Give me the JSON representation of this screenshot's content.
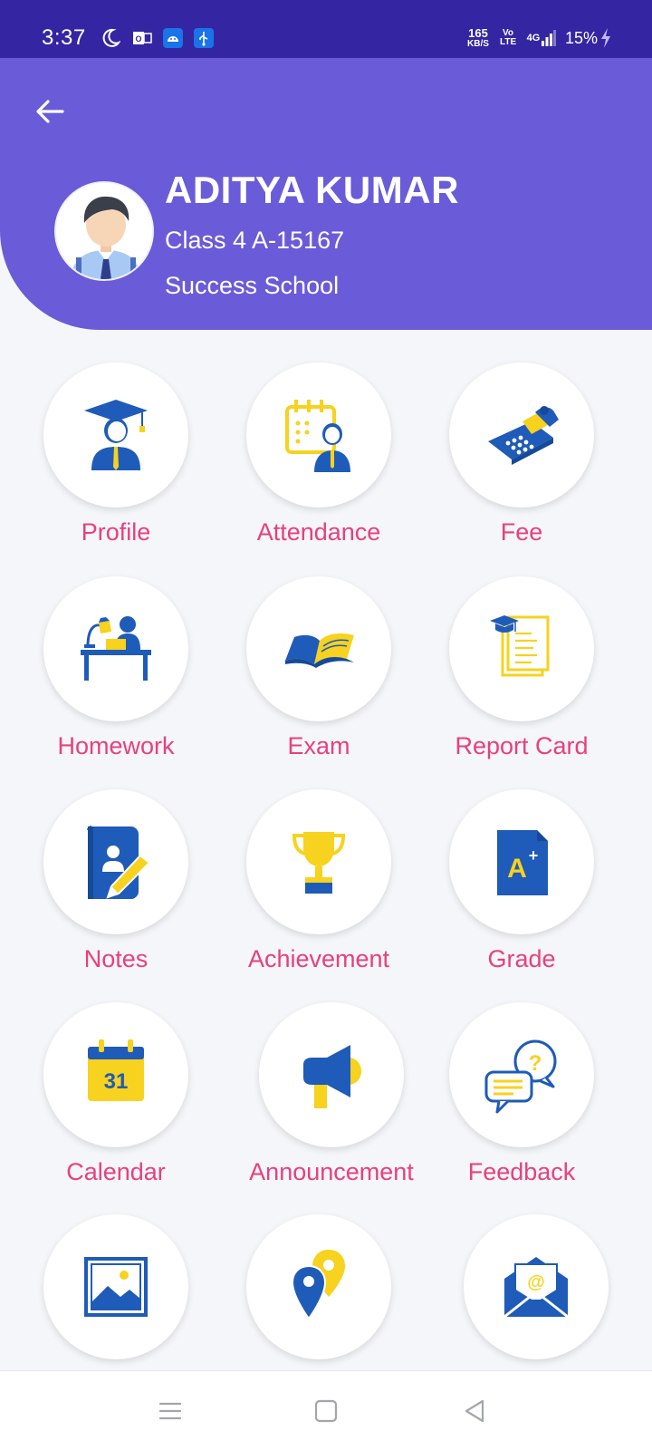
{
  "status_bar": {
    "time": "3:37",
    "net_speed_value": "165",
    "net_speed_unit": "KB/S",
    "volte": "Vo LTE",
    "network": "4G",
    "battery": "15%",
    "icons": [
      "moon-icon",
      "outlook-icon",
      "android-icon",
      "usb-icon",
      "volte-icon",
      "signal-icon",
      "charging-icon"
    ]
  },
  "header": {
    "back_icon": "arrow-left-icon",
    "student": {
      "name": "ADITYA KUMAR",
      "class": "Class 4 A-15167",
      "school": "Success School"
    }
  },
  "menu": {
    "items": [
      {
        "label": "Profile",
        "icon": "graduate-icon"
      },
      {
        "label": "Attendance",
        "icon": "attendance-calendar-icon"
      },
      {
        "label": "Fee",
        "icon": "fee-calculator-icon"
      },
      {
        "label": "Homework",
        "icon": "study-desk-icon"
      },
      {
        "label": "Exam",
        "icon": "open-book-icon"
      },
      {
        "label": "Report Card",
        "icon": "report-card-icon"
      },
      {
        "label": "Notes",
        "icon": "notebook-pencil-icon"
      },
      {
        "label": "Achievement",
        "icon": "trophy-icon"
      },
      {
        "label": "Grade",
        "icon": "grade-a-plus-icon"
      },
      {
        "label": "Calendar",
        "icon": "calendar-31-icon"
      },
      {
        "label": "Announcement",
        "icon": "megaphone-icon"
      },
      {
        "label": "Feedback",
        "icon": "feedback-chat-icon"
      },
      {
        "label": "",
        "icon": "gallery-image-icon"
      },
      {
        "label": "",
        "icon": "location-pins-icon"
      },
      {
        "label": "",
        "icon": "email-envelope-icon"
      }
    ]
  },
  "nav_bar": {
    "icons": [
      "menu-lines-icon",
      "home-square-icon",
      "back-triangle-icon"
    ]
  },
  "colors": {
    "status_bar": "#3426a2",
    "header": "#6a5bd8",
    "label_pink": "#e8407e",
    "icon_blue": "#1f5bb8",
    "icon_yellow": "#f7d21e",
    "background": "#f5f6f9"
  }
}
